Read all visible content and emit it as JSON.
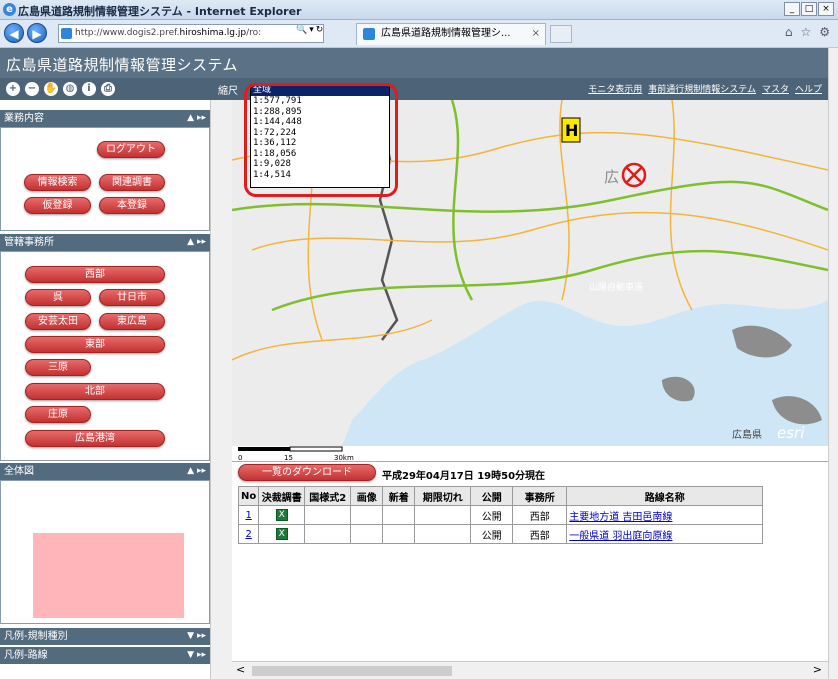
{
  "browser": {
    "window_title": "広島県道路規制情報管理システム - Internet Explorer",
    "address_prefix": "http://www.dogis2.pref.",
    "address_domain": "hiroshima.lg.jp",
    "address_suffix": "/ro:",
    "tab_title": "広島県道路規制情報管理シ...",
    "tab_close": "×"
  },
  "app": {
    "title": "広島県道路規制情報管理システム",
    "scale_label": "縮尺",
    "top_links": [
      "モニタ表示用",
      "事前通行規制情報システム",
      "マスタ",
      "ヘルプ"
    ]
  },
  "scale_dropdown": {
    "selected": "全域",
    "options": [
      "1:577,791",
      "1:288,895",
      "1:144,448",
      "1:72,224",
      "1:36,112",
      "1:18,056",
      "1:9,028",
      "1:4,514"
    ]
  },
  "panels": {
    "business": {
      "title": "業務内容",
      "logout": "ログアウト",
      "info_search": "情報検索",
      "related_survey": "関連調書",
      "temp_register": "仮登録",
      "main_register": "本登録"
    },
    "offices": {
      "title": "管轄事務所",
      "west": "西部",
      "kure": "呉",
      "hatsukaichi": "廿日市",
      "aki_ota": "安芸太田",
      "higashi_hiroshima": "東広島",
      "east": "東部",
      "mihara": "三原",
      "north": "北部",
      "shobara": "庄原",
      "port": "広島港湾"
    },
    "overview": {
      "title": "全体図"
    },
    "legend_reg": {
      "title": "凡例-規制種別"
    },
    "legend_route": {
      "title": "凡例-路線"
    }
  },
  "map": {
    "label_hiroshima": "広",
    "label_expressway": "山陽自動車道",
    "brand": "広島県",
    "esri": "esri",
    "scale_ticks": [
      "0",
      "15",
      "30km"
    ],
    "colors": {
      "water": "#cfe6f7",
      "land": "#ececec",
      "prefectural_road": "#f2b53a",
      "national_road": "#7fbf2e",
      "boundary": "#555555"
    }
  },
  "results": {
    "download_button": "一覧のダウンロード",
    "timestamp": "平成29年04月17日 19時50分現在",
    "columns": [
      "No",
      "決裁調書",
      "国様式2",
      "画像",
      "新着",
      "期限切れ",
      "公開",
      "事務所",
      "路線名称"
    ],
    "rows": [
      {
        "no": "1",
        "decision": "X",
        "form2": "",
        "image": "",
        "new": "",
        "expired": "",
        "public": "公開",
        "office": "西部",
        "route": "主要地方道 吉田邑南線"
      },
      {
        "no": "2",
        "decision": "X",
        "form2": "",
        "image": "",
        "new": "",
        "expired": "",
        "public": "公開",
        "office": "西部",
        "route": "一般県道 羽出庭向原線"
      }
    ]
  },
  "panel_controls": {
    "collapse": "▲",
    "arrows": "▸▸",
    "expand": "▼"
  },
  "scroll": {
    "left_arrow": "<",
    "right_arrow": ">"
  }
}
